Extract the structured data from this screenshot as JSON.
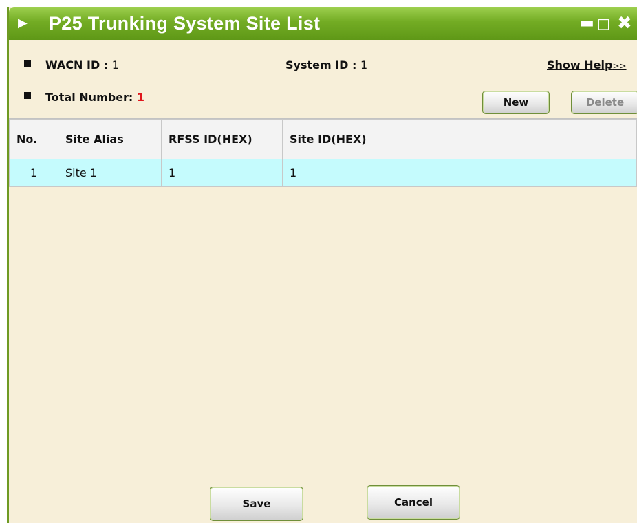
{
  "window": {
    "title": "P25 Trunking System Site List"
  },
  "info": {
    "wacn_label": "WACN ID : ",
    "wacn_value": "1",
    "system_label": "System ID : ",
    "system_value": "1",
    "total_label": "Total Number: ",
    "total_value": "1",
    "help_label": "Show Help",
    "help_arrows": ">>"
  },
  "buttons": {
    "new": "New",
    "delete": "Delete",
    "save": "Save",
    "cancel": "Cancel"
  },
  "table": {
    "columns": [
      "No.",
      "Site Alias",
      "RFSS ID(HEX)",
      "Site ID(HEX)"
    ],
    "rows": [
      [
        "1",
        "Site 1",
        "1",
        "1"
      ]
    ]
  },
  "colors": {
    "titlebar": "#73ac24",
    "background": "#f7efd9",
    "row_highlight": "#c5fbfd",
    "total_value": "#e0161c"
  },
  "icons": {
    "title": "play-arrow-icon",
    "minimize": "minimize-icon",
    "maximize": "maximize-icon",
    "close": "close-icon",
    "bullet": "square-bullet-icon"
  }
}
